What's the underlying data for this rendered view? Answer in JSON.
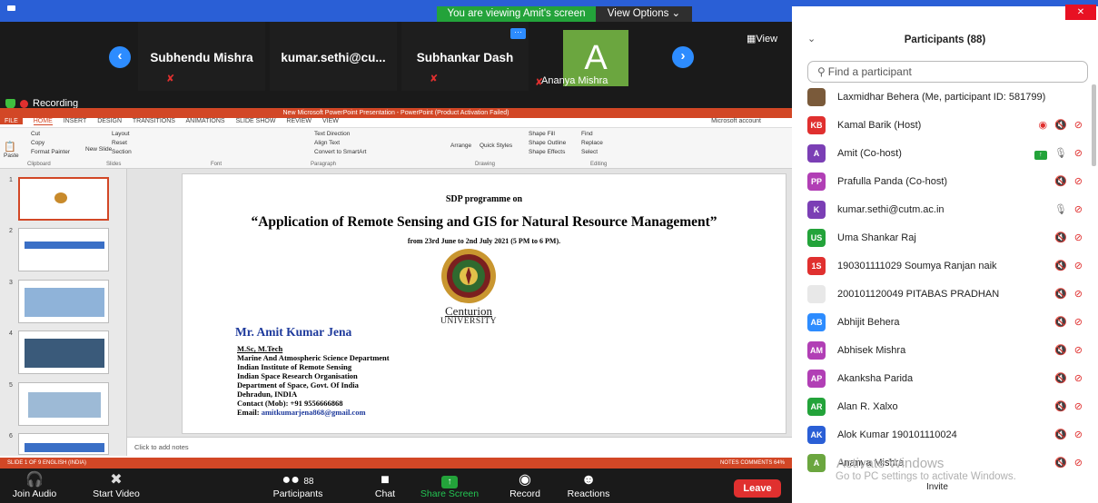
{
  "banner": {
    "viewing": "You are viewing Amit's screen",
    "view_options": "View Options"
  },
  "video_strip": {
    "tiles": [
      {
        "name": "Subhendu Mishra"
      },
      {
        "name": "kumar.sethi@cu..."
      },
      {
        "name": "Subhankar Dash"
      }
    ],
    "avatar_tile": {
      "letter": "A",
      "name": "Ananya Mishra",
      "color": "#6ba63f"
    },
    "more_label": "···",
    "view_label": "View"
  },
  "recording_label": "Recording",
  "ppt": {
    "window_title": "New Microsoft PowerPoint Presentation - PowerPoint (Product Activation Failed)",
    "menu": [
      "FILE",
      "HOME",
      "INSERT",
      "DESIGN",
      "TRANSITIONS",
      "ANIMATIONS",
      "SLIDE SHOW",
      "REVIEW",
      "VIEW"
    ],
    "account": "Microsoft account",
    "ribbon": {
      "cut": "Cut",
      "copy": "Copy",
      "format_painter": "Format Painter",
      "paste": "Paste",
      "new_slide": "New Slide",
      "layout": "Layout",
      "reset": "Reset",
      "section": "Section",
      "text_direction": "Text Direction",
      "align_text": "Align Text",
      "convert_smartart": "Convert to SmartArt",
      "arrange": "Arrange",
      "quick_styles": "Quick Styles",
      "shape_fill": "Shape Fill",
      "shape_outline": "Shape Outline",
      "shape_effects": "Shape Effects",
      "find": "Find",
      "replace": "Replace",
      "select": "Select",
      "groups": [
        "Clipboard",
        "Slides",
        "Font",
        "Paragraph",
        "Drawing",
        "Editing"
      ]
    },
    "thumb_numbers": [
      "1",
      "2",
      "3",
      "4",
      "5",
      "6"
    ],
    "slide": {
      "subtitle": "SDP programme on",
      "title": "“Application of Remote Sensing and GIS for Natural Resource Management”",
      "dates": "from 23rd June to 2nd July 2021 (5 PM to 6 PM).",
      "logo_name": "Centurion",
      "logo_sub": "UNIVERSITY",
      "speaker": "Mr. Amit Kumar Jena",
      "lines": [
        "M.Sc, M.Tech",
        "Marine And Atmospheric Science Department",
        "Indian Institute of Remote Sensing",
        "Indian Space Research Organisation",
        "Department of Space, Govt. Of India",
        "Dehradun, INDIA",
        "Contact (Mob): +91 9556666868"
      ],
      "email_label": "Email: ",
      "email": "amitkumarjena868@gmail.com"
    },
    "notes_placeholder": "Click to add notes",
    "status_left": "SLIDE 1 OF 9   ENGLISH (INDIA)",
    "status_right": "NOTES   COMMENTS   64%"
  },
  "toolbar": {
    "join_audio": "Join Audio",
    "start_video": "Start Video",
    "participants": "Participants",
    "participants_count": "88",
    "chat": "Chat",
    "share_screen": "Share Screen",
    "record": "Record",
    "reactions": "Reactions",
    "leave": "Leave"
  },
  "panel": {
    "title": "Participants (88)",
    "find_placeholder": "Find a participant",
    "participants": [
      {
        "initials": "",
        "name": "Laxmidhar Behera (Me, participant ID: 581799)",
        "color": "#7a5a3a",
        "status": []
      },
      {
        "initials": "KB",
        "name": "Kamal Barik (Host)",
        "color": "#e0302f",
        "status": [
          "rec",
          "mic-off",
          "vid-off"
        ]
      },
      {
        "initials": "A",
        "name": "Amit (Co-host)",
        "color": "#7b3fb5",
        "status": [
          "share",
          "mic-on",
          "vid-off"
        ]
      },
      {
        "initials": "PP",
        "name": "Prafulla Panda (Co-host)",
        "color": "#b13fb5",
        "status": [
          "mic-off",
          "vid-off"
        ]
      },
      {
        "initials": "K",
        "name": "kumar.sethi@cutm.ac.in",
        "color": "#7b3fb5",
        "status": [
          "mic-on",
          "vid-off"
        ]
      },
      {
        "initials": "US",
        "name": "Uma Shankar Raj",
        "color": "#23a33a",
        "status": [
          "mic-off",
          "vid-off"
        ]
      },
      {
        "initials": "1S",
        "name": "190301111029 Soumya Ranjan naik",
        "color": "#e0302f",
        "status": [
          "mic-off",
          "vid-off"
        ]
      },
      {
        "initials": "",
        "name": "200101120049 PITABAS PRADHAN",
        "color": "#e8e8e8",
        "status": [
          "mic-off",
          "vid-off"
        ]
      },
      {
        "initials": "AB",
        "name": "Abhijit Behera",
        "color": "#2d8cff",
        "status": [
          "mic-off",
          "vid-off"
        ]
      },
      {
        "initials": "AM",
        "name": "Abhisek Mishra",
        "color": "#b13fb5",
        "status": [
          "mic-off",
          "vid-off"
        ]
      },
      {
        "initials": "AP",
        "name": "Akanksha Parida",
        "color": "#b13fb5",
        "status": [
          "mic-off",
          "vid-off"
        ]
      },
      {
        "initials": "AR",
        "name": "Alan R. Xalxo",
        "color": "#23a33a",
        "status": [
          "mic-off",
          "vid-off"
        ]
      },
      {
        "initials": "AK",
        "name": "Alok Kumar 190101110024",
        "color": "#2a5fd6",
        "status": [
          "mic-off",
          "vid-off"
        ]
      },
      {
        "initials": "A",
        "name": "Ananya Mishra",
        "color": "#6ba63f",
        "status": [
          "mic-off",
          "vid-off"
        ]
      }
    ],
    "activate_title": "Activate Windows",
    "activate_sub": "Go to PC settings to activate Windows.",
    "invite": "Invite"
  }
}
